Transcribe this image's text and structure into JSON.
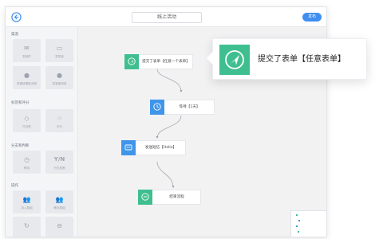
{
  "header": {
    "title": "线上活动",
    "publish_label": "发布"
  },
  "sidebar": {
    "sections": [
      {
        "title": "渠道",
        "items": [
          {
            "label": "发邮件",
            "icon": "mail-icon"
          },
          {
            "label": "发短信",
            "icon": "sms-icon"
          },
          {
            "label": "发微信模板消息",
            "icon": "wechat-icon"
          },
          {
            "label": "发客服消息",
            "icon": "wechat-icon"
          }
        ]
      },
      {
        "title": "标签和评分",
        "items": [
          {
            "label": "打标签",
            "icon": "tag-icon"
          },
          {
            "label": "评分",
            "icon": "thumbs-up-icon"
          }
        ]
      },
      {
        "title": "分支和判断",
        "items": [
          {
            "label": "等待",
            "icon": "clock-icon"
          },
          {
            "label": "分支判断",
            "icon": "yn-icon",
            "glyph": "Y/N"
          }
        ]
      },
      {
        "title": "操作",
        "items": [
          {
            "label": "加入群组",
            "icon": "users-icon"
          },
          {
            "label": "移出群组",
            "icon": "users-icon"
          },
          {
            "label": "",
            "icon": "refresh-icon"
          },
          {
            "label": "",
            "icon": "end-icon"
          }
        ]
      }
    ]
  },
  "flow": {
    "nodes": [
      {
        "label": "提交了表单【任意一个表单】",
        "icon": "send-icon",
        "color": "#3fbf8f"
      },
      {
        "label": "等待【1天】",
        "icon": "clock-icon",
        "color": "#3f95ea"
      },
      {
        "label": "发送短信【Hello】",
        "icon": "sms-icon",
        "color": "#3f95ea"
      },
      {
        "label": "结束流程",
        "icon": "end-icon",
        "color": "#3fbf8f"
      }
    ]
  },
  "callout": {
    "label": "提交了表单【任意表单】",
    "icon": "send-icon",
    "color": "#3fbf8f"
  },
  "colors": {
    "accent": "#3f8ef0",
    "green": "#3fbf8f",
    "blue": "#3f95ea"
  }
}
